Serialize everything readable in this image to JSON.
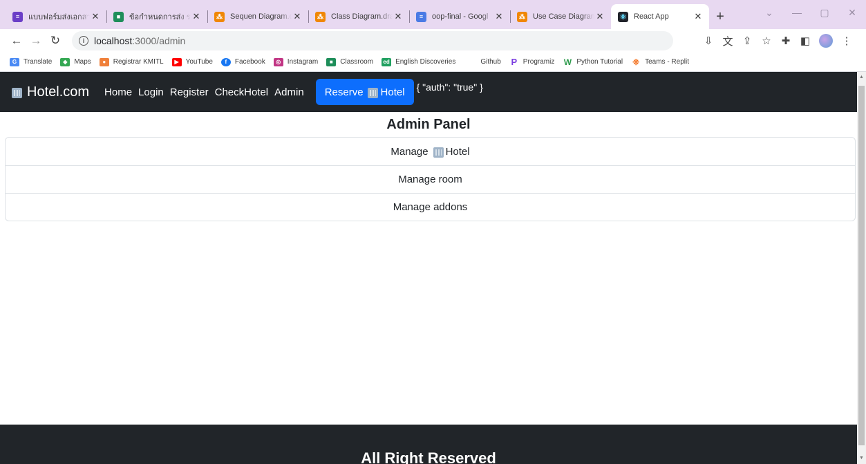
{
  "browser": {
    "tabs": [
      {
        "title": "แบบฟอร์มส่งเอกสารโ",
        "icon": "sheets-icon",
        "active": false
      },
      {
        "title": "ข้อกำหนดการส่ง รา",
        "icon": "classroom-icon",
        "active": false
      },
      {
        "title": "Sequen Diagram.d",
        "icon": "drawio-icon",
        "active": false
      },
      {
        "title": "Class Diagram.dra",
        "icon": "drawio-icon",
        "active": false
      },
      {
        "title": "oop-final - Googl",
        "icon": "docs-icon",
        "active": false
      },
      {
        "title": "Use Case Diagram",
        "icon": "drawio-icon",
        "active": false
      },
      {
        "title": "React App",
        "icon": "react-icon",
        "active": true
      }
    ],
    "address": {
      "host": "localhost",
      "path": ":3000/admin"
    },
    "bookmarks": [
      {
        "label": "Translate",
        "icon": "translate-icon",
        "color": "#4a8af4"
      },
      {
        "label": "Maps",
        "icon": "maps-icon",
        "color": "#34a853"
      },
      {
        "label": "Registrar KMITL",
        "icon": "registrar-icon",
        "color": "#f0803a"
      },
      {
        "label": "YouTube",
        "icon": "youtube-icon",
        "color": "#ff0000"
      },
      {
        "label": "Facebook",
        "icon": "facebook-icon",
        "color": "#1877f2"
      },
      {
        "label": "Instagram",
        "icon": "instagram-icon",
        "color": "#c13584"
      },
      {
        "label": "Classroom",
        "icon": "classroom-icon",
        "color": "#1e8e5a"
      },
      {
        "label": "English Discoveries",
        "icon": "ed-icon",
        "color": "#20a060"
      },
      {
        "label": "Github",
        "icon": "github-icon",
        "color": ""
      },
      {
        "label": "Programiz",
        "icon": "programiz-icon",
        "color": "#7a3de0"
      },
      {
        "label": "Python Tutorial",
        "icon": "w3-icon",
        "color": "#2f9c4e"
      },
      {
        "label": "Teams - Replit",
        "icon": "replit-icon",
        "color": "#f26207"
      }
    ]
  },
  "site": {
    "brand": "Hotel.com",
    "nav": [
      "Home",
      "Login",
      "Register",
      "CheckHotel",
      "Admin"
    ],
    "reserve_prefix": "Reserve",
    "reserve_suffix": "Hotel",
    "auth_json": "{ \"auth\": \"true\" }",
    "accent": "#0d6efd",
    "navbar_color": "#212529"
  },
  "admin": {
    "title": "Admin Panel",
    "items": [
      {
        "prefix": "Manage",
        "suffix": "Hotel",
        "icon": "hotel-icon"
      },
      {
        "prefix": "Manage room",
        "suffix": "",
        "icon": ""
      },
      {
        "prefix": "Manage addons",
        "suffix": "",
        "icon": ""
      }
    ]
  },
  "footer": {
    "text": "All Right Reserved"
  }
}
